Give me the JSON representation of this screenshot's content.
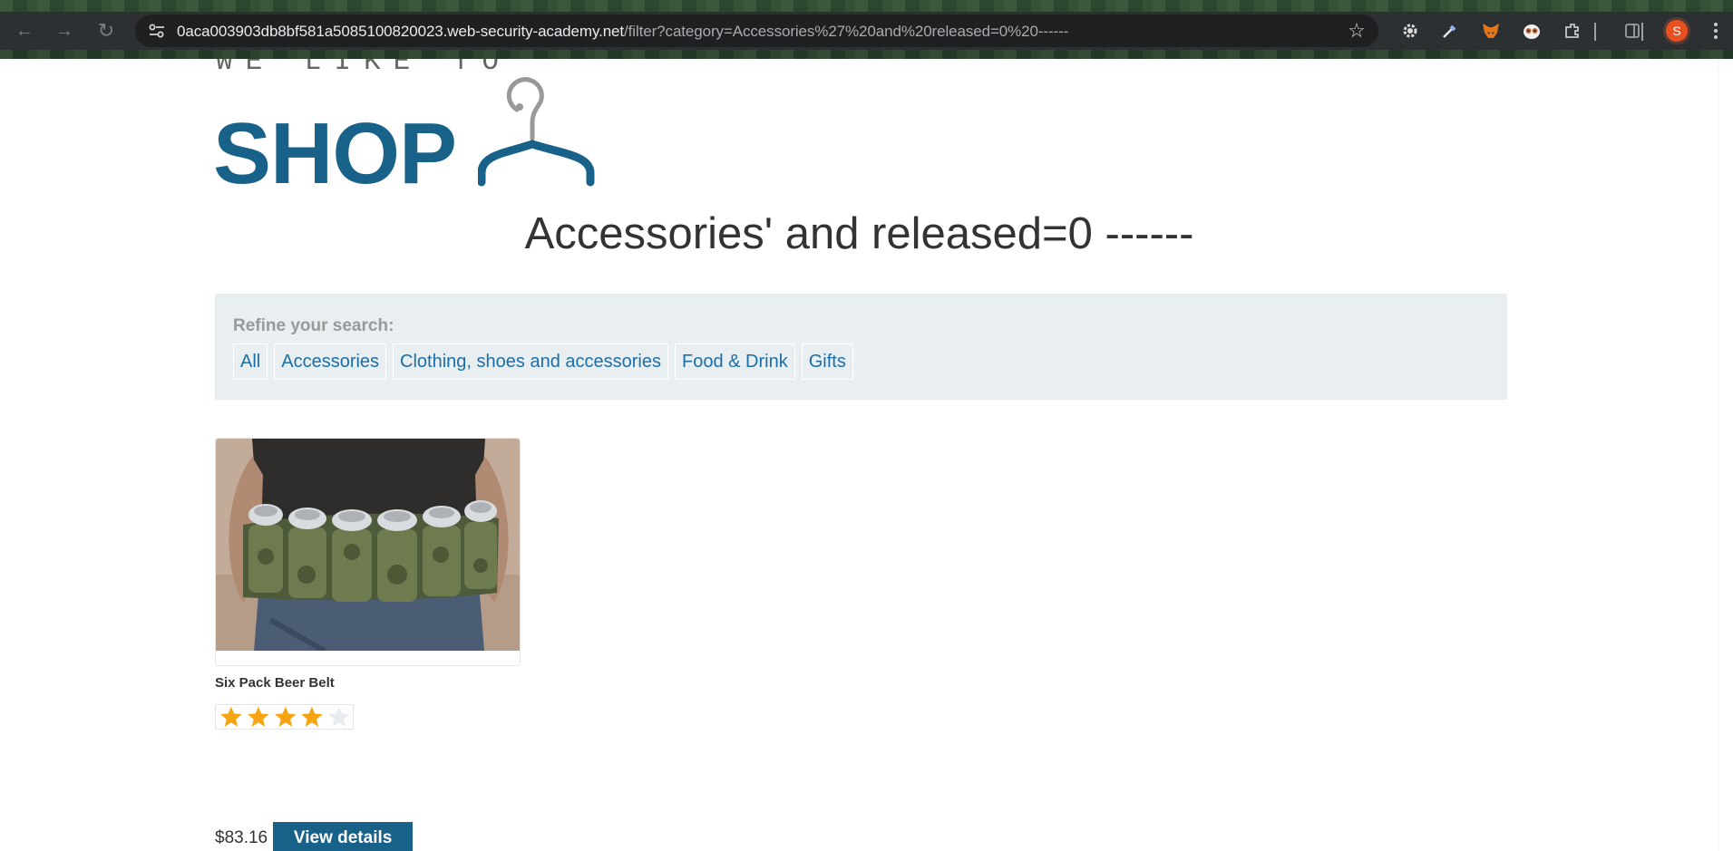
{
  "browser": {
    "url_host": "0aca003903db8bf581a5085100820023.web-security-academy.net",
    "url_path": "/filter?category=Accessories%27%20and%20released=0%20------",
    "profile_initial": "S"
  },
  "logo": {
    "tagline": "WE LIKE TO",
    "word": "SHOP",
    "color": "#186189"
  },
  "page_title": "Accessories' and released=0 ------",
  "filter": {
    "title": "Refine your search:",
    "links": [
      "All",
      "Accessories",
      "Clothing, shoes and accessories",
      "Food & Drink",
      "Gifts"
    ]
  },
  "product": {
    "name": "Six Pack Beer Belt",
    "rating": 4,
    "rating_max": 5,
    "price": "$83.16",
    "button_label": "View details"
  }
}
